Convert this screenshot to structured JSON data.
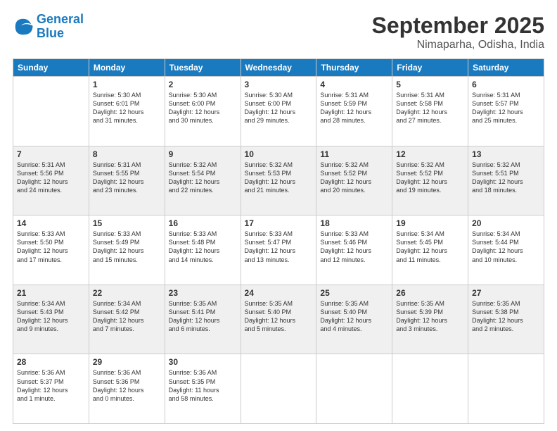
{
  "header": {
    "logo_general": "General",
    "logo_blue": "Blue",
    "month_title": "September 2025",
    "location": "Nimaparha, Odisha, India"
  },
  "days_of_week": [
    "Sunday",
    "Monday",
    "Tuesday",
    "Wednesday",
    "Thursday",
    "Friday",
    "Saturday"
  ],
  "weeks": [
    [
      {
        "num": "",
        "info": ""
      },
      {
        "num": "1",
        "info": "Sunrise: 5:30 AM\nSunset: 6:01 PM\nDaylight: 12 hours\nand 31 minutes."
      },
      {
        "num": "2",
        "info": "Sunrise: 5:30 AM\nSunset: 6:00 PM\nDaylight: 12 hours\nand 30 minutes."
      },
      {
        "num": "3",
        "info": "Sunrise: 5:30 AM\nSunset: 6:00 PM\nDaylight: 12 hours\nand 29 minutes."
      },
      {
        "num": "4",
        "info": "Sunrise: 5:31 AM\nSunset: 5:59 PM\nDaylight: 12 hours\nand 28 minutes."
      },
      {
        "num": "5",
        "info": "Sunrise: 5:31 AM\nSunset: 5:58 PM\nDaylight: 12 hours\nand 27 minutes."
      },
      {
        "num": "6",
        "info": "Sunrise: 5:31 AM\nSunset: 5:57 PM\nDaylight: 12 hours\nand 25 minutes."
      }
    ],
    [
      {
        "num": "7",
        "info": "Sunrise: 5:31 AM\nSunset: 5:56 PM\nDaylight: 12 hours\nand 24 minutes."
      },
      {
        "num": "8",
        "info": "Sunrise: 5:31 AM\nSunset: 5:55 PM\nDaylight: 12 hours\nand 23 minutes."
      },
      {
        "num": "9",
        "info": "Sunrise: 5:32 AM\nSunset: 5:54 PM\nDaylight: 12 hours\nand 22 minutes."
      },
      {
        "num": "10",
        "info": "Sunrise: 5:32 AM\nSunset: 5:53 PM\nDaylight: 12 hours\nand 21 minutes."
      },
      {
        "num": "11",
        "info": "Sunrise: 5:32 AM\nSunset: 5:52 PM\nDaylight: 12 hours\nand 20 minutes."
      },
      {
        "num": "12",
        "info": "Sunrise: 5:32 AM\nSunset: 5:52 PM\nDaylight: 12 hours\nand 19 minutes."
      },
      {
        "num": "13",
        "info": "Sunrise: 5:32 AM\nSunset: 5:51 PM\nDaylight: 12 hours\nand 18 minutes."
      }
    ],
    [
      {
        "num": "14",
        "info": "Sunrise: 5:33 AM\nSunset: 5:50 PM\nDaylight: 12 hours\nand 17 minutes."
      },
      {
        "num": "15",
        "info": "Sunrise: 5:33 AM\nSunset: 5:49 PM\nDaylight: 12 hours\nand 15 minutes."
      },
      {
        "num": "16",
        "info": "Sunrise: 5:33 AM\nSunset: 5:48 PM\nDaylight: 12 hours\nand 14 minutes."
      },
      {
        "num": "17",
        "info": "Sunrise: 5:33 AM\nSunset: 5:47 PM\nDaylight: 12 hours\nand 13 minutes."
      },
      {
        "num": "18",
        "info": "Sunrise: 5:33 AM\nSunset: 5:46 PM\nDaylight: 12 hours\nand 12 minutes."
      },
      {
        "num": "19",
        "info": "Sunrise: 5:34 AM\nSunset: 5:45 PM\nDaylight: 12 hours\nand 11 minutes."
      },
      {
        "num": "20",
        "info": "Sunrise: 5:34 AM\nSunset: 5:44 PM\nDaylight: 12 hours\nand 10 minutes."
      }
    ],
    [
      {
        "num": "21",
        "info": "Sunrise: 5:34 AM\nSunset: 5:43 PM\nDaylight: 12 hours\nand 9 minutes."
      },
      {
        "num": "22",
        "info": "Sunrise: 5:34 AM\nSunset: 5:42 PM\nDaylight: 12 hours\nand 7 minutes."
      },
      {
        "num": "23",
        "info": "Sunrise: 5:35 AM\nSunset: 5:41 PM\nDaylight: 12 hours\nand 6 minutes."
      },
      {
        "num": "24",
        "info": "Sunrise: 5:35 AM\nSunset: 5:40 PM\nDaylight: 12 hours\nand 5 minutes."
      },
      {
        "num": "25",
        "info": "Sunrise: 5:35 AM\nSunset: 5:40 PM\nDaylight: 12 hours\nand 4 minutes."
      },
      {
        "num": "26",
        "info": "Sunrise: 5:35 AM\nSunset: 5:39 PM\nDaylight: 12 hours\nand 3 minutes."
      },
      {
        "num": "27",
        "info": "Sunrise: 5:35 AM\nSunset: 5:38 PM\nDaylight: 12 hours\nand 2 minutes."
      }
    ],
    [
      {
        "num": "28",
        "info": "Sunrise: 5:36 AM\nSunset: 5:37 PM\nDaylight: 12 hours\nand 1 minute."
      },
      {
        "num": "29",
        "info": "Sunrise: 5:36 AM\nSunset: 5:36 PM\nDaylight: 12 hours\nand 0 minutes."
      },
      {
        "num": "30",
        "info": "Sunrise: 5:36 AM\nSunset: 5:35 PM\nDaylight: 11 hours\nand 58 minutes."
      },
      {
        "num": "",
        "info": ""
      },
      {
        "num": "",
        "info": ""
      },
      {
        "num": "",
        "info": ""
      },
      {
        "num": "",
        "info": ""
      }
    ]
  ]
}
